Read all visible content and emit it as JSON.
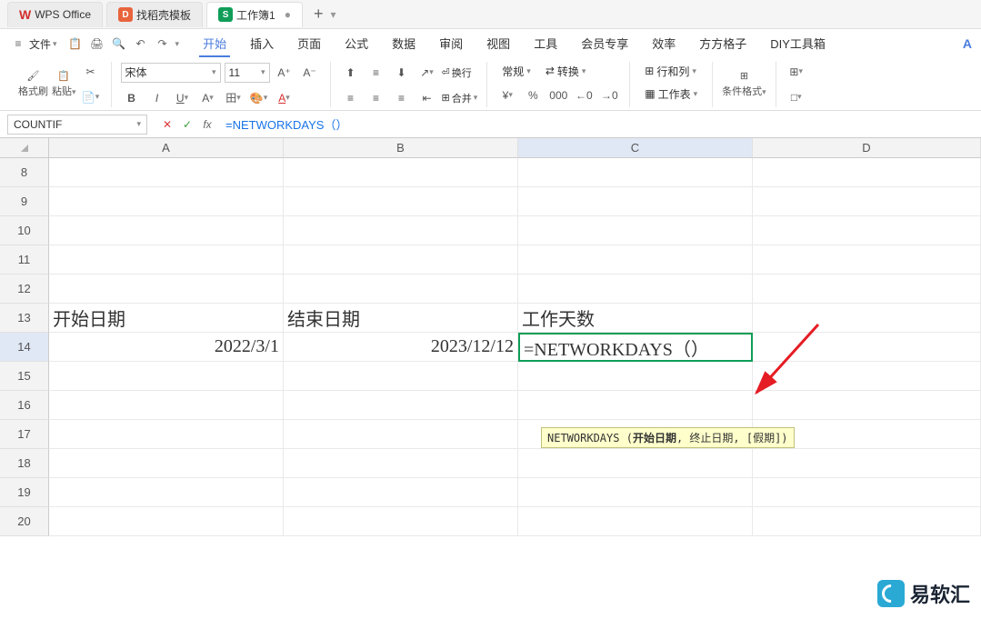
{
  "titleTabs": {
    "wps": "WPS Office",
    "template": "找稻壳模板",
    "workbook": "工作簿1"
  },
  "fileMenu": "文件",
  "menuTabs": [
    "开始",
    "插入",
    "页面",
    "公式",
    "数据",
    "审阅",
    "视图",
    "工具",
    "会员专享",
    "效率",
    "方方格子",
    "DIY工具箱"
  ],
  "toolbar": {
    "formatBrush": "格式刷",
    "paste": "粘贴",
    "font": "宋体",
    "fontSize": "11",
    "general": "常规",
    "convert": "转换",
    "rows": "行和列",
    "worksheet": "工作表",
    "condFormat": "条件格式",
    "wrap": "换行",
    "merge": "合并"
  },
  "cellName": "COUNTIF",
  "formula": "=NETWORKDAYS（）",
  "columns": [
    "A",
    "B",
    "C",
    "D"
  ],
  "rows": [
    "8",
    "9",
    "10",
    "11",
    "12",
    "13",
    "14",
    "15",
    "16",
    "17",
    "18",
    "19",
    "20"
  ],
  "cells": {
    "A13": "开始日期",
    "B13": "结束日期",
    "C13": "工作天数",
    "A14": "2022/3/1",
    "B14": "2023/12/12",
    "C14": "=NETWORKDAYS（）"
  },
  "tooltip": {
    "fn": "NETWORKDAYS",
    "p1": "开始日期",
    "rest": ", 终止日期, [假期])"
  },
  "watermark": "易软汇"
}
